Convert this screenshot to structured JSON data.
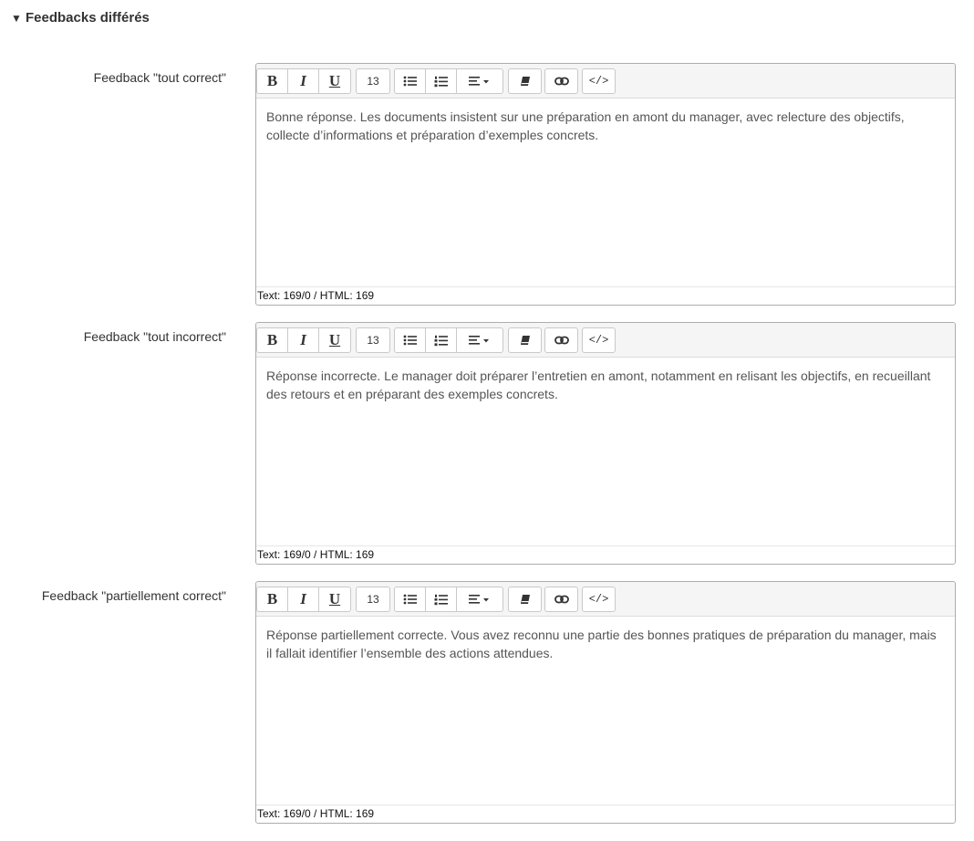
{
  "section": {
    "caret": "▼",
    "title": "Feedbacks différés"
  },
  "toolbar": {
    "bold": "B",
    "italic": "I",
    "underline": "U",
    "font_size": "13",
    "code": "</>"
  },
  "editors": [
    {
      "label": "Feedback \"tout correct\"",
      "content": "Bonne réponse. Les documents insistent sur une préparation en amont du manager, avec relecture des objectifs, collecte d’informations et préparation d’exemples concrets.",
      "status": "Text: 169/0 / HTML: 169"
    },
    {
      "label": "Feedback \"tout incorrect\"",
      "content": "Réponse incorrecte. Le manager doit préparer l’entretien en amont, notamment en relisant les objectifs, en recueillant des retours et en préparant des exemples concrets.",
      "status": "Text: 169/0 / HTML: 169"
    },
    {
      "label": "Feedback \"partiellement correct\"",
      "content": "Réponse partiellement correcte. Vous avez reconnu une partie des bonnes pratiques de préparation du manager, mais il fallait identifier l’ensemble des actions attendues.",
      "status": "Text: 169/0 / HTML: 169"
    }
  ]
}
